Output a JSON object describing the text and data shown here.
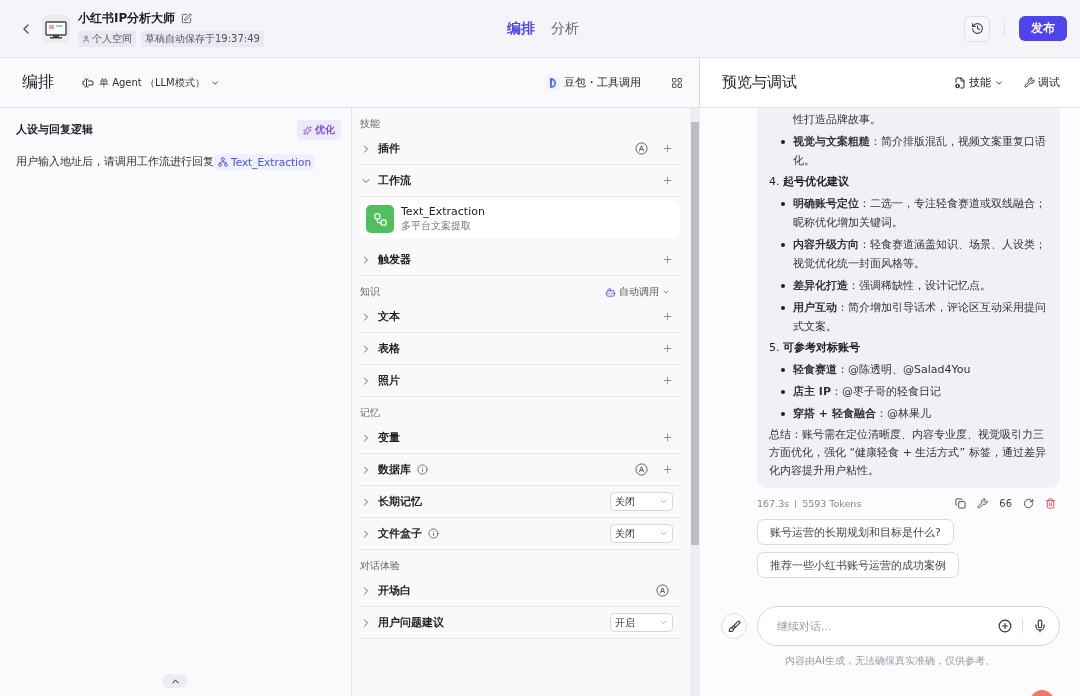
{
  "header": {
    "bot_name": "小红书IP分析大师",
    "space": "个人空间",
    "autosave": "草稿自动保存于19:37:49",
    "tabs": [
      {
        "label": "编排",
        "selected": true
      },
      {
        "label": "分析",
        "selected": false
      }
    ],
    "publish": "发布"
  },
  "toolbar": {
    "title": "编排",
    "mode": "单 Agent （LLM模式）",
    "model": "豆包・工具调用"
  },
  "prompt": {
    "title": "人设与回复逻辑",
    "optimize": "优化",
    "text": "用户输入地址后，请调用工作流进行回复",
    "workflow_ref": "Text_Extraction"
  },
  "sections": [
    {
      "title": "技能",
      "items": [
        {
          "label": "插件",
          "kind": "add",
          "expanded": false,
          "auto": true,
          "info": false
        },
        {
          "label": "工作流",
          "kind": "add",
          "expanded": true,
          "auto": false,
          "info": false,
          "children": [
            {
              "name": "Text_Extraction",
              "desc": "多平台文案提取"
            }
          ]
        },
        {
          "label": "触发器",
          "kind": "add",
          "expanded": false,
          "auto": false,
          "info": false
        }
      ]
    },
    {
      "title": "知识",
      "action": "自动调用",
      "items": [
        {
          "label": "文本",
          "kind": "add",
          "expanded": false,
          "auto": false,
          "info": false
        },
        {
          "label": "表格",
          "kind": "add",
          "expanded": false,
          "auto": false,
          "info": false
        },
        {
          "label": "照片",
          "kind": "add",
          "expanded": false,
          "auto": false,
          "info": false
        }
      ]
    },
    {
      "title": "记忆",
      "items": [
        {
          "label": "变量",
          "kind": "add",
          "expanded": false,
          "auto": false,
          "info": false
        },
        {
          "label": "数据库",
          "kind": "add",
          "expanded": false,
          "auto": true,
          "info": true
        },
        {
          "label": "长期记忆",
          "kind": "select",
          "value": "关闭",
          "expanded": false,
          "auto": false,
          "info": false
        },
        {
          "label": "文件盒子",
          "kind": "select",
          "value": "关闭",
          "expanded": false,
          "auto": false,
          "info": true
        }
      ]
    },
    {
      "title": "对话体验",
      "items": [
        {
          "label": "开场白",
          "kind": "none",
          "expanded": false,
          "auto": true,
          "info": false
        },
        {
          "label": "用户问题建议",
          "kind": "select",
          "value": "开启",
          "expanded": false,
          "auto": false,
          "info": false
        }
      ]
    }
  ],
  "preview": {
    "title": "预览与调试",
    "skills": "技能",
    "debug": "调试"
  },
  "message": {
    "blocks": [
      {
        "kind": "tail",
        "text": "性打造品牌故事。"
      },
      {
        "kind": "bullet",
        "text": "**视觉与文案粗糙**：简介排版混乱，视频文案重复口语化。"
      },
      {
        "kind": "heading",
        "text": "4. **起号优化建议**"
      },
      {
        "kind": "bullet",
        "text": "**明确账号定位**：二选一，专注轻食赛道或双线融合；昵称优化增加关键词。"
      },
      {
        "kind": "bullet",
        "text": "**内容升级方向**：轻食赛道涵盖知识、场景、人设类；视觉优化统一封面风格等。"
      },
      {
        "kind": "bullet",
        "text": "**差异化打造**：强调稀缺性，设计记忆点。"
      },
      {
        "kind": "bullet",
        "text": "**用户互动**：简介增加引导话术，评论区互动采用提问式文案。"
      },
      {
        "kind": "heading",
        "text": "5. **可参考对标账号**"
      },
      {
        "kind": "bullet",
        "text": "**轻食赛道**：@陈透明、@Salad4You"
      },
      {
        "kind": "bullet",
        "text": "**店主 IP**：@枣子哥的轻食日记"
      },
      {
        "kind": "bullet",
        "text": "**穿搭 + 轻食融合**：@林果儿"
      },
      {
        "kind": "paragraph",
        "text": "总结：账号需在定位清晰度、内容专业度、视觉吸引力三方面优化，强化 “健康轻食 + 生活方式” 标签，通过差异化内容提升用户粘性。"
      }
    ],
    "time": "167.3s",
    "tokens": "5593 Tokens",
    "quote": "66"
  },
  "suggestions": [
    "账号运营的长期规划和目标是什么?",
    "推荐一些小红书账号运营的成功案例"
  ],
  "input": {
    "placeholder": "继续对话..."
  },
  "disclaimer": "内容由AI生成，无法确保真实准确，仅供参考。"
}
